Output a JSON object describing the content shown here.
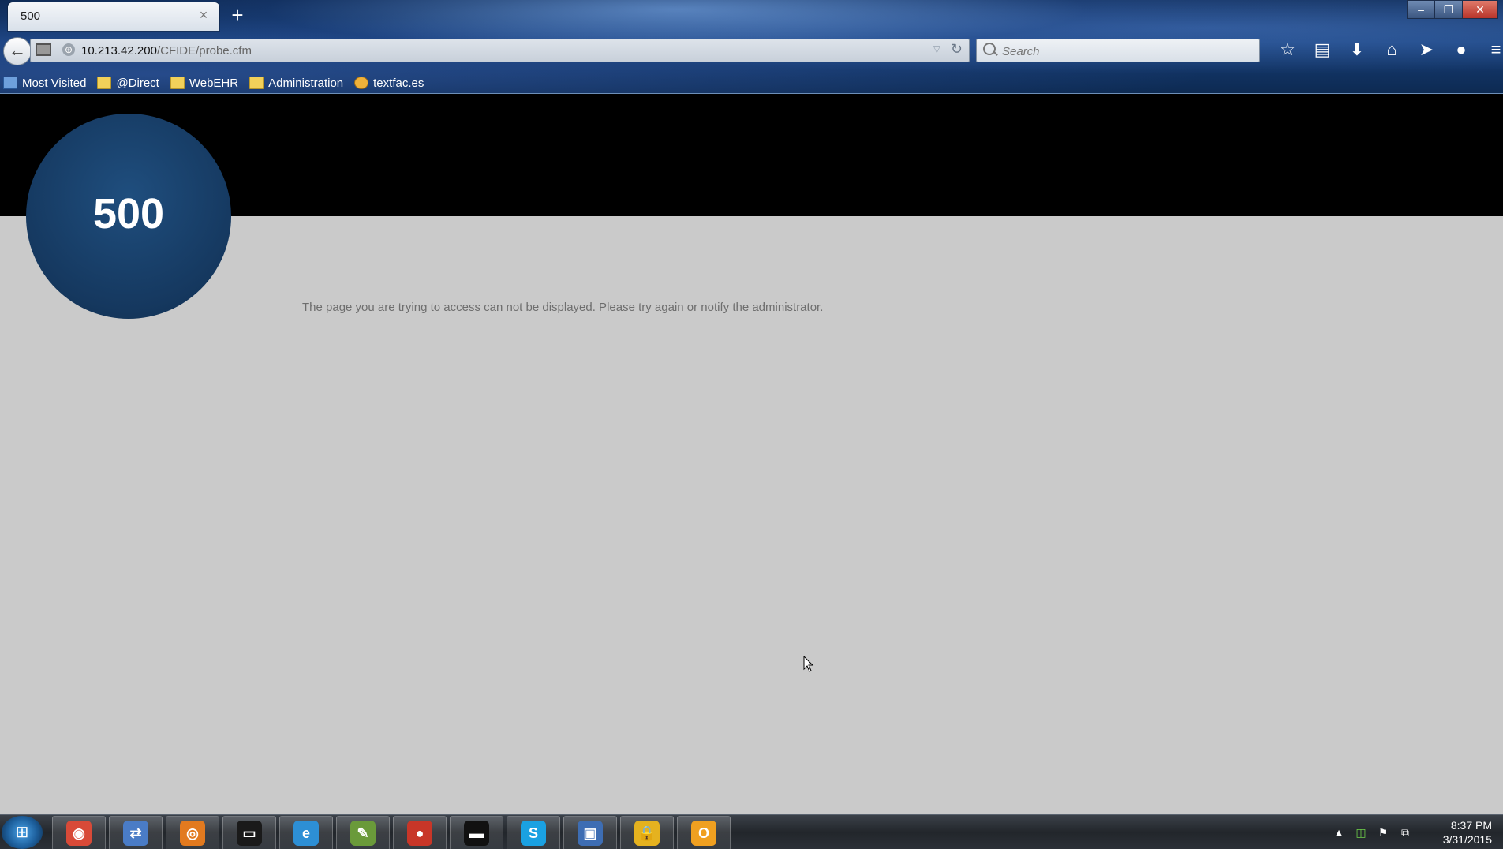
{
  "tab": {
    "title": "500",
    "close_glyph": "×",
    "new_tab_glyph": "+"
  },
  "window_controls": {
    "minimize": "–",
    "restore": "❐",
    "close": "✕"
  },
  "address_bar": {
    "host": "10.213.42.200",
    "path": "/CFIDE/probe.cfm"
  },
  "search": {
    "placeholder": "Search"
  },
  "toolbar": [
    "bookmark-star-icon",
    "reading-list-icon",
    "downloads-icon",
    "home-icon",
    "send-icon",
    "chat-icon",
    "menu-icon"
  ],
  "bookmarks": [
    {
      "label": "Most Visited",
      "icon": "blue-sq"
    },
    {
      "label": "@Direct",
      "icon": "folder"
    },
    {
      "label": "WebEHR",
      "icon": "folder"
    },
    {
      "label": "Administration",
      "icon": "folder"
    },
    {
      "label": "textfac.es",
      "icon": "face"
    }
  ],
  "error": {
    "code": "500",
    "message": "The page you are trying to access can not be displayed. Please try again or notify the administrator."
  },
  "taskbar": {
    "apps": [
      {
        "name": "chrome",
        "color": "#d84a38",
        "glyph": "◉"
      },
      {
        "name": "remote-desktop",
        "color": "#4a7cc6",
        "glyph": "⇄"
      },
      {
        "name": "firefox",
        "color": "#e27a1f",
        "glyph": "◎"
      },
      {
        "name": "explorer",
        "color": "#1a1a1a",
        "glyph": "▭"
      },
      {
        "name": "internet-explorer",
        "color": "#2d8fd5",
        "glyph": "e"
      },
      {
        "name": "notepad",
        "color": "#6a9a3a",
        "glyph": "✎"
      },
      {
        "name": "app-red",
        "color": "#c83628",
        "glyph": "●"
      },
      {
        "name": "cmd",
        "color": "#111111",
        "glyph": "▬"
      },
      {
        "name": "skype",
        "color": "#1aa1e2",
        "glyph": "S"
      },
      {
        "name": "network-drive",
        "color": "#3d6db3",
        "glyph": "▣"
      },
      {
        "name": "lock-app",
        "color": "#e5b21f",
        "glyph": "🔒"
      },
      {
        "name": "outlook",
        "color": "#f0a020",
        "glyph": "O"
      }
    ],
    "clock_time": "8:37 PM",
    "clock_date": "3/31/2015"
  }
}
